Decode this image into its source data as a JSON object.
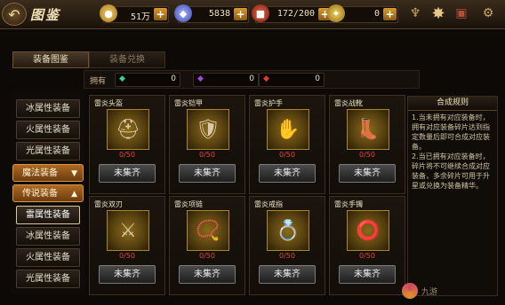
{
  "header": {
    "title": "图鉴",
    "resources": [
      {
        "icon": "gold-coin-icon",
        "glyph": "●",
        "color": "#d4a02a",
        "value": "51万"
      },
      {
        "icon": "diamond-icon",
        "glyph": "◆",
        "color": "#6a7ad8",
        "value": "5838"
      },
      {
        "icon": "stamina-icon",
        "glyph": "■",
        "color": "#b83a2a",
        "value": "172/200"
      },
      {
        "icon": "token-icon",
        "glyph": "✦",
        "color": "#c9a030",
        "value": "0"
      }
    ]
  },
  "tabs": [
    "装备图鉴",
    "装备兑换"
  ],
  "owned": {
    "label": "拥有",
    "shards": [
      {
        "icon": "green-shard-icon",
        "glyph": "◆",
        "color": "#3ad08a",
        "value": "0"
      },
      {
        "icon": "purple-shard-icon",
        "glyph": "◆",
        "color": "#a04ad8",
        "value": "0"
      },
      {
        "icon": "red-shard-icon",
        "glyph": "◆",
        "color": "#e03a3a",
        "value": "0"
      }
    ]
  },
  "sidebar": {
    "items_top": [
      "冰属性装备",
      "火属性装备",
      "光属性装备"
    ],
    "categories": [
      "魔法装备",
      "传说装备"
    ],
    "items_bottom": [
      "雷属性装备",
      "冰属性装备",
      "火属性装备",
      "光属性装备"
    ]
  },
  "cards": [
    {
      "name": "雷炎头盔",
      "glyph": "⛑",
      "progress": "0/50",
      "button": "未集齐"
    },
    {
      "name": "雷炎铠甲",
      "glyph": "🛡",
      "progress": "0/50",
      "button": "未集齐"
    },
    {
      "name": "雷炎护手",
      "glyph": "✋",
      "progress": "0/50",
      "button": "未集齐"
    },
    {
      "name": "雷炎战靴",
      "glyph": "👢",
      "progress": "0/50",
      "button": "未集齐"
    },
    {
      "name": "雷炎双刃",
      "glyph": "⚔",
      "progress": "0/50",
      "button": "未集齐"
    },
    {
      "name": "雷炎项链",
      "glyph": "📿",
      "progress": "0/50",
      "button": "未集齐"
    },
    {
      "name": "雷炎戒指",
      "glyph": "💍",
      "progress": "0/50",
      "button": "未集齐"
    },
    {
      "name": "雷炎手镯",
      "glyph": "⭕",
      "progress": "0/50",
      "button": "未集齐"
    }
  ],
  "rules": {
    "title": "合成规则",
    "text": "1.当未拥有对应装备时，拥有对应装备碎片达到指定数量后即可合成对应装备。\n2.当已拥有对应装备时，碎片将不可继续合成对应装备，多余碎片可用于升星或兑换为装备精华。"
  },
  "watermark": "九游"
}
